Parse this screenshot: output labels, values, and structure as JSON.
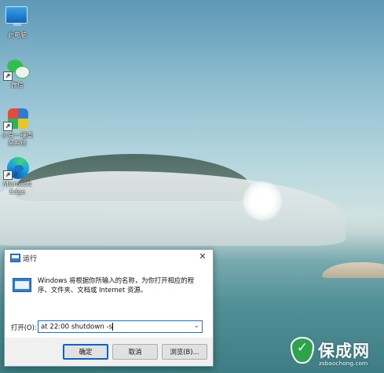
{
  "desktop": {
    "icons": [
      {
        "label": "此电脑",
        "icon": "computer-icon"
      },
      {
        "label": "微信",
        "icon": "wechat-icon"
      },
      {
        "label": "小白一键重装系统",
        "icon": "app-icon"
      },
      {
        "label": "Microsoft Edge",
        "icon": "edge-icon"
      }
    ]
  },
  "run_dialog": {
    "title": "运行",
    "close_glyph": "✕",
    "description": "Windows 将根据你所输入的名称，为你打开相应的程序、文件夹、文档或 Internet 资源。",
    "open_label": "打开(O):",
    "command_value": "at 22:00 shutdown -s",
    "dropdown_glyph": "⌄",
    "buttons": {
      "ok": "确定",
      "cancel": "取消",
      "browse": "浏览(B)..."
    }
  },
  "watermark": {
    "title": "保成网",
    "url": "zsbaochong.com",
    "color": "#2fa34a"
  },
  "colors": {
    "accent": "#1e73c8",
    "dialog_bg": "#f0f0f0"
  }
}
